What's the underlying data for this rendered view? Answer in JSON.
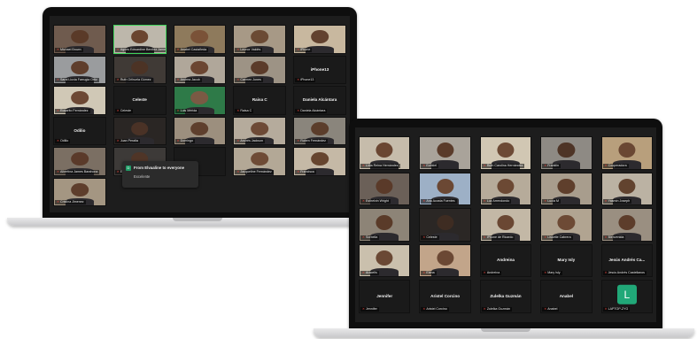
{
  "laptop_left": {
    "chat_popup": {
      "avatar_letter": "D",
      "title": "From Elvaaline to everyone",
      "message": "Excelente"
    },
    "tiles": [
      {
        "name": "Michael Brown",
        "big": "",
        "skin": "#5a3a28",
        "bg": "#6f5b4e"
      },
      {
        "name": "Agnes Edwardine Benítez James",
        "big": "",
        "skin": "#6a4530",
        "bg": "#bdb7ab",
        "active": true
      },
      {
        "name": "Anabel Castañeda",
        "big": "",
        "skin": "#7a5238",
        "bg": "#8e7a5c"
      },
      {
        "name": "Leonor Valdés",
        "big": "",
        "skin": "#6b4a34",
        "bg": "#a79986"
      },
      {
        "name": "iPhone",
        "big": "",
        "skin": "#62422f",
        "bg": "#c8b89f"
      },
      {
        "name": "Sarai Lluvia Farrugia Ortiz",
        "big": "",
        "skin": "#5f3e2c",
        "bg": "#9a9c9e"
      },
      {
        "name": "Ruth Orihuela Gómez",
        "big": "",
        "skin": "#4c3325",
        "bg": "#403a36"
      },
      {
        "name": "Andrea Jacob",
        "big": "",
        "skin": "#6b4632",
        "bg": "#b0a79a"
      },
      {
        "name": "Carmen Jones",
        "big": "",
        "skin": "#5b3b2a",
        "bg": "#9d9385"
      },
      {
        "name": "iPhone13",
        "big": "iPhone13",
        "skin": "",
        "bg": ""
      },
      {
        "name": "Rosarito Fernández",
        "big": "",
        "skin": "#6c4834",
        "bg": "#d0c8b6"
      },
      {
        "name": "Celeste",
        "big": "Celeste",
        "skin": "",
        "bg": ""
      },
      {
        "name": "Luis Mérida",
        "big": "",
        "skin": "#7a5a44",
        "bg": "#2e7a48"
      },
      {
        "name": "Raisa C",
        "big": "Raisa C",
        "skin": "",
        "bg": ""
      },
      {
        "name": "Daniela Alcántara",
        "big": "Daniela Alcántara",
        "skin": "",
        "bg": ""
      },
      {
        "name": "Odilio",
        "big": "Odilio",
        "skin": "",
        "bg": ""
      },
      {
        "name": "Juan Peralta",
        "big": "",
        "skin": "#4a3226",
        "bg": "#2a2624"
      },
      {
        "name": "Domingo",
        "big": "",
        "skin": "#5e3f2d",
        "bg": "#9c8f7e"
      },
      {
        "name": "Andrés Jackson",
        "big": "",
        "skin": "#6d4a36",
        "bg": "#b5ab9c"
      },
      {
        "name": "Ruben Fernández",
        "big": "",
        "skin": "#5b3d2b",
        "bg": "#8a857c"
      },
      {
        "name": "Albertina James Barahona",
        "big": "",
        "skin": "#5a3a2a",
        "bg": "#7b6f63"
      },
      {
        "name": "Ed",
        "big": "",
        "skin": "#4f3527",
        "bg": "#3d3a38"
      },
      {
        "name": "",
        "big": "",
        "skin": "",
        "bg": ""
      },
      {
        "name": "Jacqueline Fernández",
        "big": "",
        "skin": "#6e4b36",
        "bg": "#b3a896"
      },
      {
        "name": "Francisca",
        "big": "",
        "skin": "#66452f",
        "bg": "#c5b9a6"
      },
      {
        "name": "Cristina Jimenez",
        "big": "",
        "skin": "#5e3e2c",
        "bg": "#a49682"
      }
    ]
  },
  "laptop_right": {
    "tiles": [
      {
        "name": "Lidia Reina Hernández",
        "big": "",
        "skin": "#6a4632",
        "bg": "#c6bcab"
      },
      {
        "name": "Ezekiel",
        "big": "",
        "skin": "#5a3b2a",
        "bg": "#a9a39a"
      },
      {
        "name": "Ruth Carolina Hernández",
        "big": "",
        "skin": "#6d4a35",
        "bg": "#d1c7b3"
      },
      {
        "name": "Franklin",
        "big": "",
        "skin": "#4e3426",
        "bg": "#8e8a84"
      },
      {
        "name": "Cooperadora",
        "big": "",
        "skin": "#6a4733",
        "bg": "#b89f7c"
      },
      {
        "name": "Esthelvin Wright",
        "big": "",
        "skin": "#5a3a29",
        "bg": "#6b6058"
      },
      {
        "name": "Ana Acosta Fuentes",
        "big": "",
        "skin": "#6b4834",
        "bg": "#9db0c6"
      },
      {
        "name": "Luz Arrendondo",
        "big": "",
        "skin": "#6c4934",
        "bg": "#b6ab9a"
      },
      {
        "name": "Lucía M",
        "big": "",
        "skin": "#5f3f2c",
        "bg": "#a89d8d"
      },
      {
        "name": "Yasmín Joseph",
        "big": "",
        "skin": "#62432f",
        "bg": "#bbb2a3"
      },
      {
        "name": "Sorbelia",
        "big": "",
        "skin": "#5a3b29",
        "bg": "#8d8477"
      },
      {
        "name": "Celeste",
        "big": "",
        "skin": "#3e2c22",
        "bg": "#2b2725"
      },
      {
        "name": "iPhone de Ricardo",
        "big": "",
        "skin": "#6a4733",
        "bg": "#c3b8a6"
      },
      {
        "name": "Lissette Cabrera",
        "big": "",
        "skin": "#6d4a35",
        "bg": "#b1a491"
      },
      {
        "name": "Bienvenida",
        "big": "",
        "skin": "#5d3d2b",
        "bg": "#9a8f81"
      },
      {
        "name": "Aracelis",
        "big": "",
        "skin": "#6a4834",
        "bg": "#cac0ad"
      },
      {
        "name": "Elena",
        "big": "",
        "skin": "#6b4834",
        "bg": "#c2a58a"
      },
      {
        "name": "Andreina",
        "big": "Andreina",
        "skin": "",
        "bg": ""
      },
      {
        "name": "Mary Isly",
        "big": "Mary Isly",
        "skin": "",
        "bg": ""
      },
      {
        "name": "Jesús Andrés Castellanos",
        "big": "Jesús Andrés Ca...",
        "skin": "",
        "bg": ""
      },
      {
        "name": "Jennifer",
        "big": "Jennifer",
        "skin": "",
        "bg": ""
      },
      {
        "name": "Aristel Corcino",
        "big": "Aristel Corcino",
        "skin": "",
        "bg": ""
      },
      {
        "name": "Zulelka Guzmán",
        "big": "Zulelka Guzmán",
        "skin": "",
        "bg": ""
      },
      {
        "name": "Anabel",
        "big": "Anabel",
        "skin": "",
        "bg": ""
      },
      {
        "name": "LAPTOP-ZYG",
        "big": "",
        "skin": "",
        "bg": "",
        "avatar": "L"
      }
    ]
  }
}
